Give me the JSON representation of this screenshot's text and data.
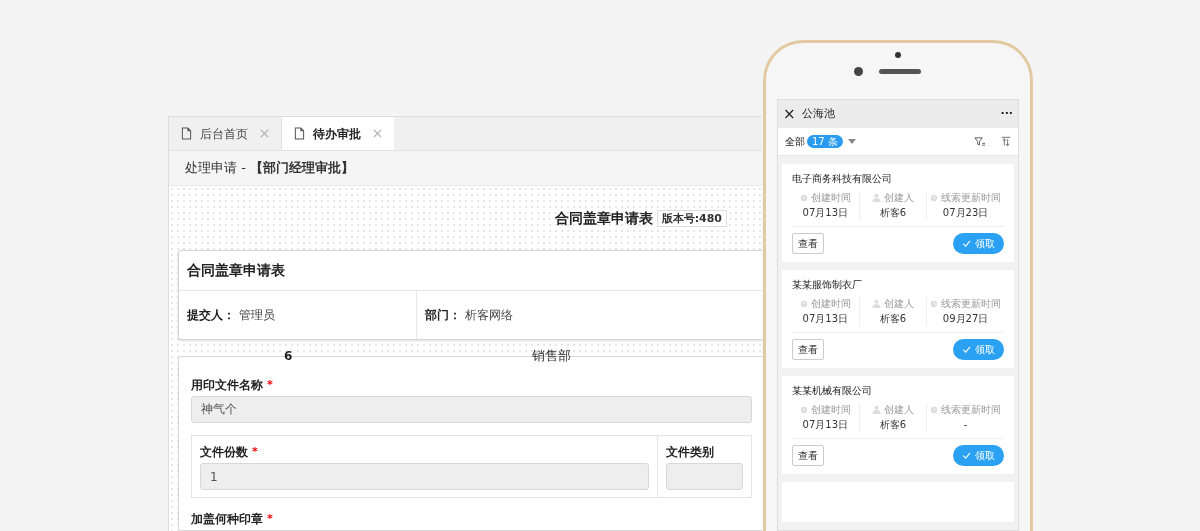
{
  "desktop": {
    "tabs": [
      {
        "label": "后台首页",
        "selected": false
      },
      {
        "label": "待办审批",
        "selected": true
      }
    ],
    "header": "处理申请 - **【部门经理审批】**",
    "form_title": "合同盖章申请表",
    "version": "版本号:480",
    "info_card": {
      "title": "合同盖章申请表",
      "fields": [
        {
          "label": "提交人：",
          "value": "管理员"
        },
        {
          "label": "部门：",
          "value": "析客网络"
        }
      ]
    },
    "overlay_texts": [
      "6",
      "销售部"
    ],
    "form": {
      "name_field": {
        "label": "用印文件名称",
        "required_mark": "*",
        "value": "神气个"
      },
      "row_fields": [
        {
          "label": "文件份数",
          "required_mark": "*",
          "value": "1"
        },
        {
          "label": "文件类别"
        }
      ],
      "seal_field": {
        "label": "加盖何种印章",
        "required_mark": "*"
      }
    }
  },
  "phone": {
    "title": "公海池",
    "close": "×",
    "more": "···",
    "filter": {
      "label": "全部",
      "count": "17 条"
    },
    "cards": [
      {
        "company": "电子商务科技有限公司",
        "stats": [
          {
            "label": "创建时间",
            "value": "07月13日"
          },
          {
            "label": "创建人",
            "value": "析客6"
          },
          {
            "label": "线索更新时间",
            "value": "07月23日"
          }
        ],
        "view": "查看",
        "claim": "领取"
      },
      {
        "company": "某某服饰制衣厂",
        "stats": [
          {
            "label": "创建时间",
            "value": "07月13日"
          },
          {
            "label": "创建人",
            "value": "析客6"
          },
          {
            "label": "线索更新时间",
            "value": "09月27日"
          }
        ],
        "view": "查看",
        "claim": "领取"
      },
      {
        "company": "某某机械有限公司",
        "stats": [
          {
            "label": "创建时间",
            "value": "07月13日"
          },
          {
            "label": "创建人",
            "value": "析客6"
          },
          {
            "label": "线索更新时间",
            "value": "-"
          }
        ],
        "view": "查看",
        "claim": "领取"
      }
    ]
  }
}
